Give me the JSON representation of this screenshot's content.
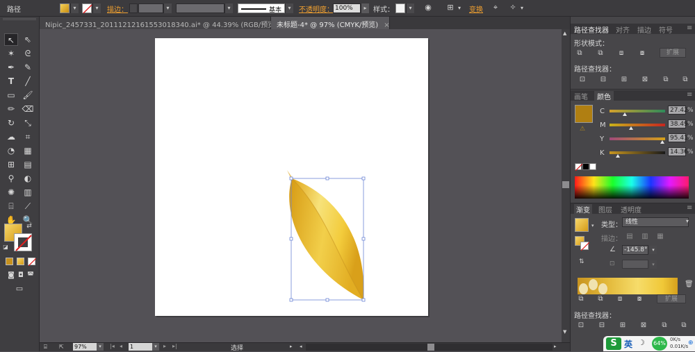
{
  "control_bar": {
    "mode_label": "路径",
    "stroke_label": "描边：",
    "brush_label": "基本",
    "opacity_label": "不透明度：",
    "opacity_value": "100%",
    "style_label": "样式：",
    "transform_label": "变换",
    "fill_color": "#d4a12a"
  },
  "tabs": [
    {
      "label": "Nipic_2457331_20111212161553018340.ai* @ 44.39% (RGB/预览)",
      "close": "×"
    },
    {
      "label": "未标题-4* @ 97% (CMYK/预览)",
      "close": "×"
    }
  ],
  "status": {
    "zoom": "97%",
    "page": "1",
    "tool": "选择"
  },
  "pathfinder": {
    "tabs": [
      "路径查找器",
      "对齐",
      "描边",
      "符号"
    ],
    "shape_modes_label": "形状模式：",
    "expand_label": "扩展",
    "pathfinders_label": "路径查找器："
  },
  "color": {
    "tabs": [
      "画笔",
      "颜色"
    ],
    "swatch": "#b07f12",
    "channels": [
      {
        "name": "C",
        "value": "27.42",
        "unit": "%",
        "pos": 0.274
      },
      {
        "name": "M",
        "value": "38.49",
        "unit": "%",
        "pos": 0.385
      },
      {
        "name": "Y",
        "value": "95.41",
        "unit": "%",
        "pos": 0.954
      },
      {
        "name": "K",
        "value": "14.36",
        "unit": "%",
        "pos": 0.144
      }
    ]
  },
  "gradient": {
    "tabs": [
      "渐变",
      "图层",
      "透明度"
    ],
    "type_label": "类型：",
    "type_value": "线性",
    "stroke_label": "描边：",
    "angle_value": "-145.8°",
    "pathfinders_label": "路径查找器：",
    "expand_label": "扩展"
  },
  "taskbar": {
    "ime_label": "英",
    "battery": "64%",
    "net_up": "0K/s",
    "net_down": "0.01K/s"
  }
}
